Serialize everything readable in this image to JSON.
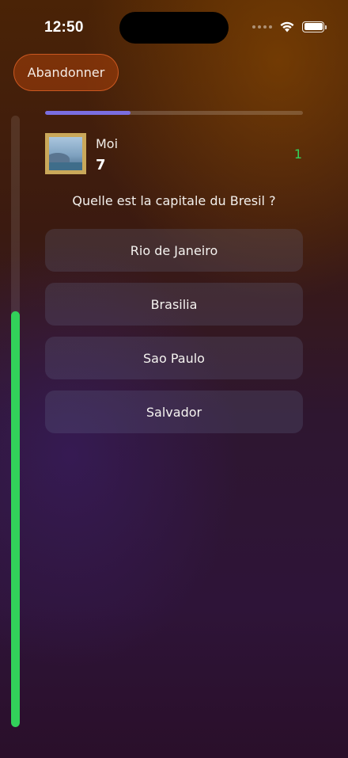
{
  "status_bar": {
    "time": "12:50"
  },
  "header": {
    "abandon_label": "Abandonner"
  },
  "timer": {
    "remaining_fraction": 0.68,
    "color": "#32d15a"
  },
  "progress": {
    "fraction": 0.33,
    "color": "#7a6ee0"
  },
  "player": {
    "name": "Moi",
    "score": "7",
    "answer_count": "1"
  },
  "question": {
    "text": "Quelle est la capitale du Bresil ?"
  },
  "options": [
    "Rio de Janeiro",
    "Brasilia",
    "Sao Paulo",
    "Salvador"
  ]
}
